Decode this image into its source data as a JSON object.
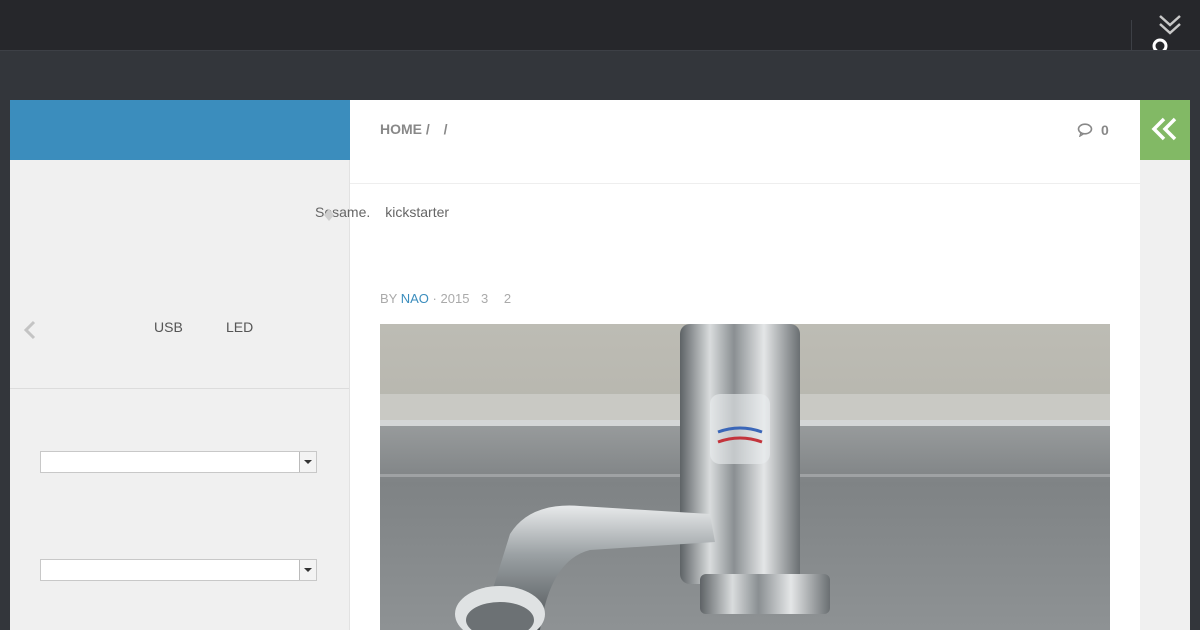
{
  "breadcrumb": {
    "home": "HOME",
    "sep1": "/",
    "sep2": "/"
  },
  "comments": {
    "count": "0",
    "icon": "comment-icon"
  },
  "intro": {
    "word1": "Sesame.",
    "word2": "kickstarter"
  },
  "sidebar": {
    "widget_words": [
      "USB",
      "LED"
    ],
    "select1_value": "",
    "select2_value": ""
  },
  "byline": {
    "by": "BY",
    "author": "NAO",
    "dot": "·",
    "year": "2015",
    "month": "3",
    "day": "2"
  },
  "colors": {
    "topbar": "#26272b",
    "header": "#33363b",
    "accent_blue": "#3b8dbd",
    "accent_green": "#82b965",
    "sidebar_bg": "#f0f0f0"
  },
  "icons": {
    "menu": "double-chevron-down-icon",
    "search": "search-icon",
    "side_toggle": "double-chevron-left-icon",
    "prev": "chevron-left-icon",
    "share": "share-arrow-icon"
  }
}
